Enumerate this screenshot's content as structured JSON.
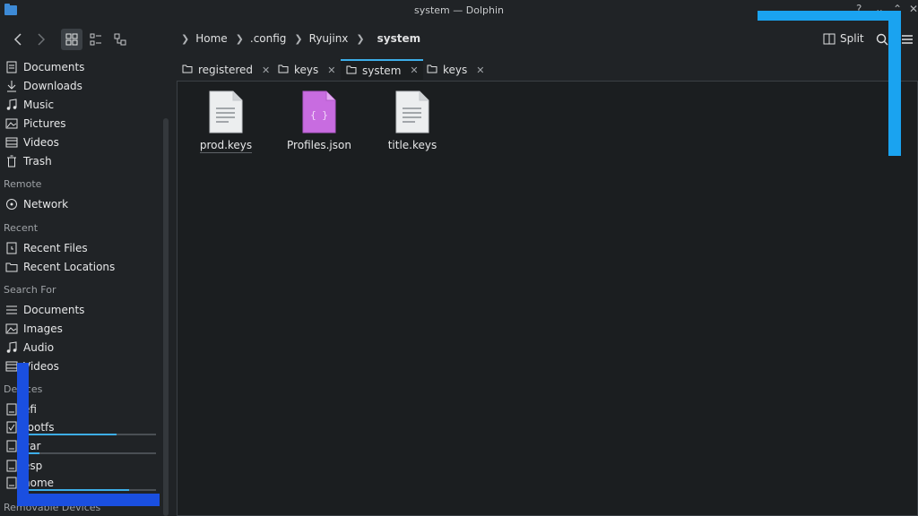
{
  "window": {
    "title": "system — Dolphin"
  },
  "breadcrumb": {
    "items": [
      "Home",
      ".config",
      "Ryujinx"
    ],
    "current": "system"
  },
  "toolbar": {
    "split_label": "Split"
  },
  "sidebar": {
    "places": [
      "Documents",
      "Downloads",
      "Music",
      "Pictures",
      "Videos",
      "Trash"
    ],
    "remote_header": "Remote",
    "remote": [
      "Network"
    ],
    "recent_header": "Recent",
    "recent": [
      "Recent Files",
      "Recent Locations"
    ],
    "search_header": "Search For",
    "search": [
      "Documents",
      "Images",
      "Audio",
      "Videos"
    ],
    "devices_header": "Devices",
    "devices": [
      "efi",
      "rootfs",
      "var",
      "esp",
      "home"
    ],
    "removable_header": "Removable Devices"
  },
  "device_usage": {
    "rootfs": 0.7,
    "var": 0.12,
    "home": 0.8
  },
  "tabs": [
    "registered",
    "keys",
    "system",
    "keys"
  ],
  "active_tab": 2,
  "files": [
    {
      "name": "prod.keys",
      "icon": "text-file-icon"
    },
    {
      "name": "Profiles.json",
      "icon": "json-file-icon"
    },
    {
      "name": "title.keys",
      "icon": "text-file-icon"
    }
  ],
  "colors": {
    "accent": "#3daee9",
    "annotation_light": "#1aa3f0",
    "annotation_dark": "#1a4fe0",
    "json_icon": "#c86ce0"
  }
}
